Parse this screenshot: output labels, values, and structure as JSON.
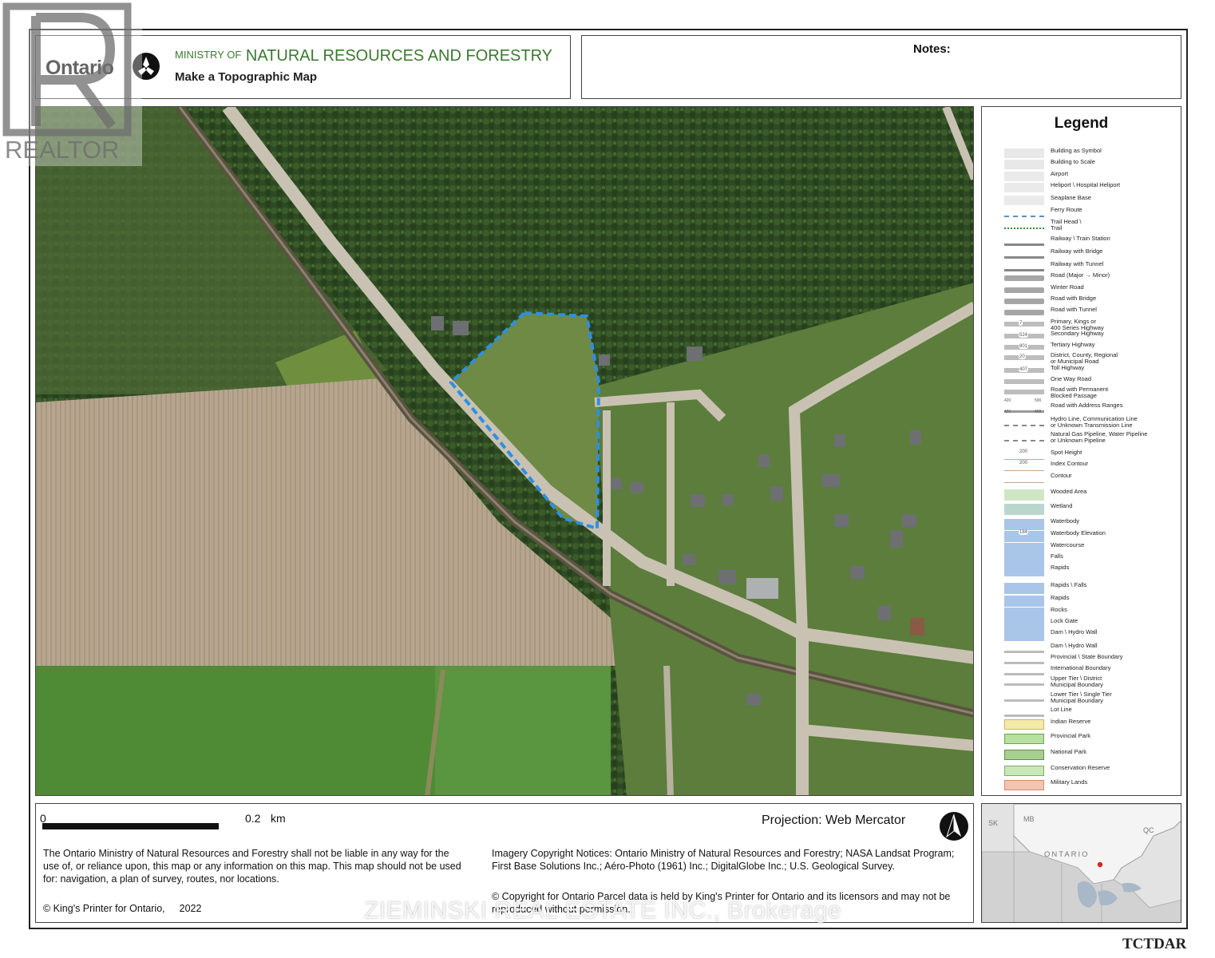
{
  "header": {
    "brand": "Ontario",
    "ministry_small": "MINISTRY OF",
    "ministry_name": "NATURAL RESOURCES AND FORESTRY",
    "subtitle": "Make a Topographic Map",
    "notes_label": "Notes:"
  },
  "legend": {
    "title": "Legend",
    "items": [
      "Building as Symbol",
      "Building to Scale",
      "Airport",
      "Heliport \\ Hospital Heliport",
      "Seaplane Base",
      "Ferry Route",
      "Trail Head \\\nTrail",
      "Railway \\ Train Station",
      "Railway with Bridge",
      "Railway with Tunnel",
      "Road (Major → Minor)",
      "Winter Road",
      "Road with Bridge",
      "Road with Tunnel",
      "Primary, Kings or\n400 Series Highway",
      "Secondary Highway",
      "Tertiary Highway",
      "District, County, Regional\nor Municipal Road",
      "Toll Highway",
      "One Way Road",
      "Road with Permanent\nBlocked Passage",
      "Road with Address Ranges",
      "Hydro Line, Communication Line\nor Unknown Transmission Line",
      "Natural Gas Pipeline, Water Pipeline\nor Unknown Pipeline",
      "Spot Height",
      "Index Contour",
      "Contour",
      "Wooded Area",
      "Wetland",
      "Waterbody",
      "Waterbody Elevation",
      "Watercourse",
      "Falls",
      "Rapids",
      "Rapids \\ Falls",
      "Rapids",
      "Rocks",
      "Lock Gate",
      "Dam \\ Hydro Wall",
      "Dam \\ Hydro Wall",
      "Provincial \\ State Boundary",
      "International Boundary",
      "Upper Tier \\ District\nMunicipal Boundary",
      "Lower Tier \\ Single Tier\nMunicipal Boundary",
      "Lot Line",
      "Indian Reserve",
      "Provincial Park",
      "National Park",
      "Conservation Reserve",
      "Military Lands"
    ],
    "symbols": {
      "Spot Height": "200",
      "Index Contour": "200",
      "Waterbody Elevation": "184",
      "Primary, Kings or\n400 Series Highway": "7",
      "Secondary Highway": "524",
      "Tertiary Highway": "801",
      "District, County, Regional\nor Municipal Road": "20",
      "Toll Highway": "407",
      "Road with Address Ranges": [
        "420",
        "500",
        "421",
        "499"
      ]
    }
  },
  "footer": {
    "scale_start": "0",
    "scale_end": "0.2",
    "scale_unit": "km",
    "projection": "Projection: Web Mercator",
    "disclaimer": "The Ontario Ministry of Natural Resources and Forestry shall not be liable in any way for the use of, or reliance upon, this map or any information on this map.  This map should not be used for: navigation, a plan of survey, routes, nor locations.",
    "copyright": "© King's Printer for Ontario,",
    "copyright_year": "2022",
    "imagery": "Imagery Copyright Notices: Ontario Ministry of Natural Resources and Forestry; NASA Landsat Program; First Base Solutions Inc.; Aéro-Photo (1961) Inc.; DigitalGlobe Inc.; U.S. Geological Survey.",
    "parcel": "© Copyright for Ontario Parcel data is held by King's Printer for Ontario and its licensors and may not be reproduced without permission."
  },
  "inset": {
    "province_label": "ONTARIO",
    "mb_label": "MB",
    "sk_label": "SK",
    "qc_label": "QC"
  },
  "watermarks": {
    "realtor": "REALTOR",
    "brokerage": "ZIEMINSKI REAL ESTATE INC., Brokerage",
    "code": "TCTDAR"
  },
  "colors": {
    "ministry_green": "#3a7a2e",
    "parcel_outline": "#2f8fe0",
    "location_marker": "#e02020"
  }
}
